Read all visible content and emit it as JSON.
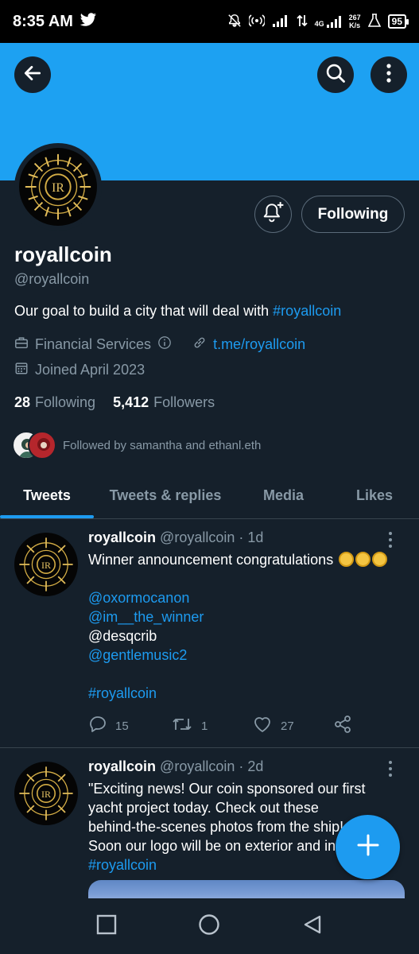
{
  "status_bar": {
    "time": "8:35 AM",
    "net_speed_value": "267",
    "net_speed_unit": "K/s",
    "network_type": "4G",
    "battery": "95"
  },
  "profile": {
    "display_name": "royallcoin",
    "handle": "@royallcoin",
    "bio_text": "Our goal to build a city that will deal with ",
    "bio_hashtag": "#royallcoin",
    "category": "Financial Services",
    "website": "t.me/royallcoin",
    "joined": "Joined April 2023",
    "following_count": "28",
    "following_label": "Following",
    "followers_count": "5,412",
    "followers_label": "Followers",
    "followed_by": "Followed by samantha and ethanl.eth",
    "following_button_label": "Following"
  },
  "tabs": [
    {
      "label": "Tweets",
      "active": true
    },
    {
      "label": "Tweets & replies",
      "active": false
    },
    {
      "label": "Media",
      "active": false
    },
    {
      "label": "Likes",
      "active": false
    }
  ],
  "tweets": [
    {
      "name": "royallcoin",
      "meta": "@royallcoin · 1d",
      "lines": {
        "l1": "Winner announcement congratulations ",
        "m1": "@oxormocanon",
        "m2": "@im__the_winner",
        "m3": "@desqcrib",
        "m4": "@gentlemusic2",
        "tag": "#royallcoin"
      },
      "replies": "15",
      "retweets": "1",
      "likes": "27"
    },
    {
      "name": "royallcoin",
      "meta": "@royallcoin · 2d",
      "lines": {
        "l1": "\"Exciting news! Our coin sponsored our first",
        "l2": "yacht project today. Check out these",
        "l3": "behind-the-scenes photos from the ship!",
        "l4": "Soon our logo will be on exterior and inside",
        "tag": "#royallcoin"
      }
    }
  ],
  "colors": {
    "background": "#15202b",
    "banner": "#1da1f2",
    "accent": "#1d9bf0",
    "secondary_text": "#8899a6",
    "divider": "#38444d"
  },
  "icons": {
    "back": "arrow-left-icon",
    "search": "search-icon",
    "more": "more-vertical-icon",
    "bell": "bell-plus-icon",
    "category": "briefcase-icon",
    "info": "info-icon",
    "link": "link-icon",
    "calendar": "calendar-icon",
    "reply": "reply-icon",
    "retweet": "retweet-icon",
    "like": "heart-icon",
    "share": "share-icon",
    "compose": "plus-icon"
  }
}
